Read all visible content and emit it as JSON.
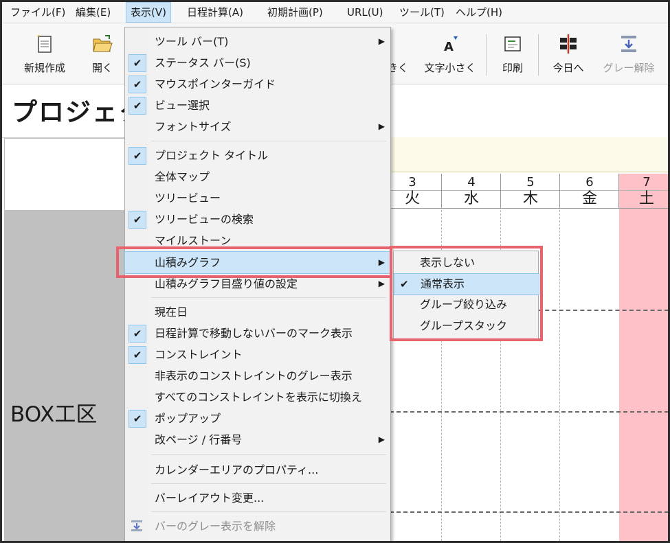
{
  "menubar": [
    "ファイル(F)",
    "編集(E)",
    "表示(V)",
    "日程計算(A)",
    "初期計画(P)",
    "URL(U)",
    "ツール(T)",
    "ヘルプ(H)"
  ],
  "toolbar": {
    "new": "新規作成",
    "open": "開く",
    "font_large_partial": "きく",
    "font_small": "文字小さく",
    "print": "印刷",
    "today": "今日へ",
    "ungray": "グレー解除"
  },
  "project_title": "プロジェク",
  "box_label": "BOX工区",
  "calendar": [
    {
      "day": "3",
      "weekday": "火"
    },
    {
      "day": "4",
      "weekday": "水"
    },
    {
      "day": "5",
      "weekday": "木"
    },
    {
      "day": "6",
      "weekday": "金"
    },
    {
      "day": "7",
      "weekday": "土"
    }
  ],
  "view_menu": {
    "items": [
      {
        "label": "ツール バー(T)",
        "checked": false,
        "submenu": true
      },
      {
        "label": "ステータス バー(S)",
        "checked": true
      },
      {
        "label": "マウスポインターガイド",
        "checked": true
      },
      {
        "label": "ビュー選択",
        "checked": true
      },
      {
        "label": "フォントサイズ",
        "checked": false,
        "submenu": true
      },
      {
        "label": "プロジェクト タイトル",
        "checked": true
      },
      {
        "label": "全体マップ",
        "checked": false
      },
      {
        "label": "ツリービュー",
        "checked": false
      },
      {
        "label": "ツリービューの検索",
        "checked": true
      },
      {
        "label": "マイルストーン",
        "checked": false
      },
      {
        "label": "山積みグラフ",
        "checked": false,
        "submenu": true,
        "highlighted": true
      },
      {
        "label": "山積みグラフ目盛り値の設定",
        "checked": false,
        "submenu": true
      },
      {
        "label": "現在日",
        "checked": false
      },
      {
        "label": "日程計算で移動しないバーのマーク表示",
        "checked": true
      },
      {
        "label": "コンストレイント",
        "checked": true
      },
      {
        "label": "非表示のコンストレイントのグレー表示",
        "checked": false
      },
      {
        "label": "すべてのコンストレイントを表示に切換え",
        "checked": false
      },
      {
        "label": "ポップアップ",
        "checked": true
      },
      {
        "label": "改ページ / 行番号",
        "checked": false,
        "submenu": true
      },
      {
        "label": "カレンダーエリアのプロパティ...",
        "checked": false
      },
      {
        "label": "バーレイアウト変更...",
        "checked": false
      },
      {
        "label": "バーのグレー表示を解除",
        "checked": false,
        "disabled": true
      }
    ]
  },
  "graph_submenu": {
    "items": [
      {
        "label": "表示しない",
        "checked": false
      },
      {
        "label": "通常表示",
        "checked": true,
        "highlighted": true
      },
      {
        "label": "グループ絞り込み",
        "checked": false
      },
      {
        "label": "グループスタック",
        "checked": false
      }
    ]
  },
  "colors": {
    "highlight": "#cde5f8",
    "check_bg": "#cce4f7",
    "saturday": "#ffc1c8",
    "callout_red": "#e9636f"
  }
}
